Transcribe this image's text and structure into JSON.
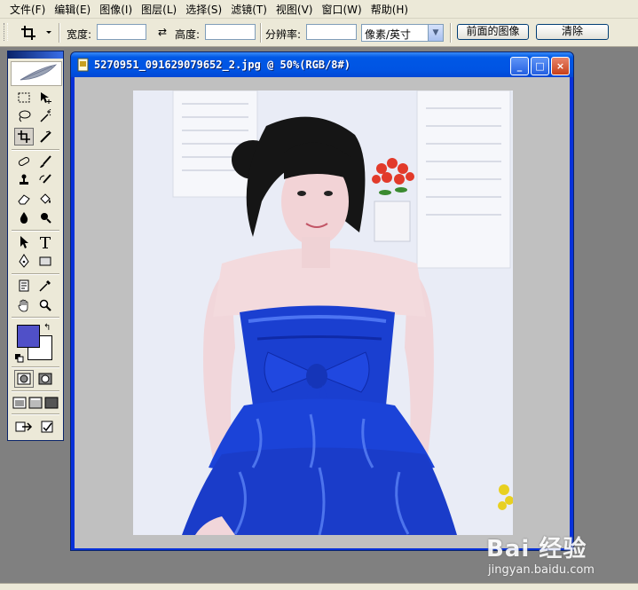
{
  "menubar": {
    "items": [
      "文件(F)",
      "编辑(E)",
      "图像(I)",
      "图层(L)",
      "选择(S)",
      "滤镜(T)",
      "视图(V)",
      "窗口(W)",
      "帮助(H)"
    ]
  },
  "options": {
    "width_label": "宽度:",
    "width_value": "",
    "height_label": "高度:",
    "height_value": "",
    "resolution_label": "分辨率:",
    "resolution_value": "",
    "unit_select": "像素/英寸",
    "front_image_button": "前面的图像",
    "clear_button": "清除"
  },
  "document": {
    "title": "5270951_091629079652_2.jpg @ 50%(RGB/8#)",
    "minimize": "_",
    "maximize": "□",
    "close": "×"
  },
  "colors": {
    "foreground": "#5050c8",
    "background": "#ffffff",
    "titlebar": "#0054e3",
    "chrome": "#ece9d8"
  },
  "watermark": {
    "brand": "Bai 经验",
    "url": "jingyan.baidu.com"
  }
}
